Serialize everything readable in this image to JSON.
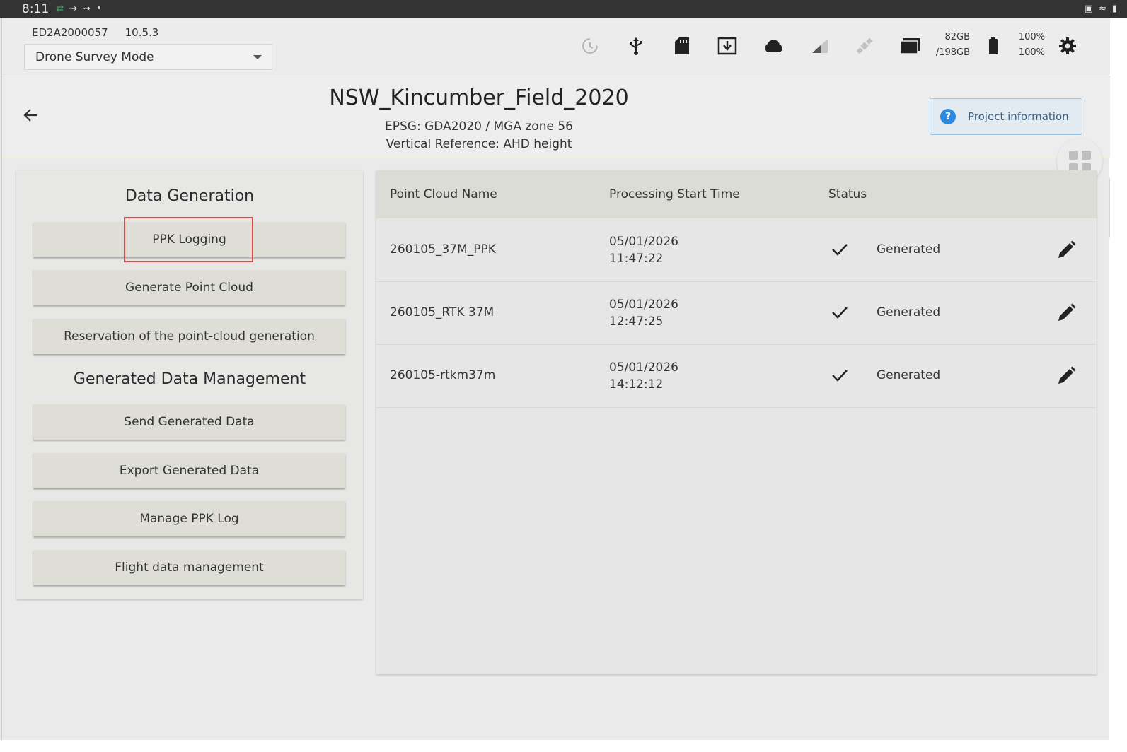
{
  "status_bar": {
    "time": "8:11"
  },
  "toolbar": {
    "device_id": "ED2A2000057",
    "version": "10.5.3",
    "mode_selected": "Drone Survey Mode",
    "storage_free": "82GB",
    "storage_total": "/198GB",
    "battery_1": "100%",
    "battery_2": "100%",
    "icons": [
      "sync-icon",
      "usb-icon",
      "sd-card-icon",
      "download-icon",
      "cloud-icon",
      "signal-icon",
      "satellite-icon",
      "storage-icon",
      "battery-icon",
      "gear-icon"
    ]
  },
  "project": {
    "title": "NSW_Kincumber_Field_2020",
    "epsg": "EPSG: GDA2020 / MGA zone 56",
    "vertical_ref": "Vertical Reference: AHD height",
    "info_button": "Project information"
  },
  "left_panel": {
    "data_generation_title": "Data Generation",
    "ppk_logging": "PPK Logging",
    "generate_point_cloud": "Generate Point Cloud",
    "reservation": "Reservation of the point-cloud generation",
    "management_title": "Generated Data Management",
    "send_generated": "Send Generated Data",
    "export_generated": "Export Generated Data",
    "manage_ppk": "Manage PPK Log",
    "flight_data": "Flight data management"
  },
  "table": {
    "columns": [
      "Point Cloud Name",
      "Processing Start Time",
      "Status"
    ],
    "rows": [
      {
        "name": "260105_37M_PPK",
        "date": "05/01/2026",
        "time": "11:47:22",
        "status": "Generated"
      },
      {
        "name": "260105_RTK 37M",
        "date": "05/01/2026",
        "time": "12:47:25",
        "status": "Generated"
      },
      {
        "name": "260105-rtkm37m",
        "date": "05/01/2026",
        "time": "14:12:12",
        "status": "Generated"
      }
    ]
  },
  "colors": {
    "highlight": "#e04848",
    "info_accent": "#2d8ae0",
    "status_bar": "#333333"
  }
}
